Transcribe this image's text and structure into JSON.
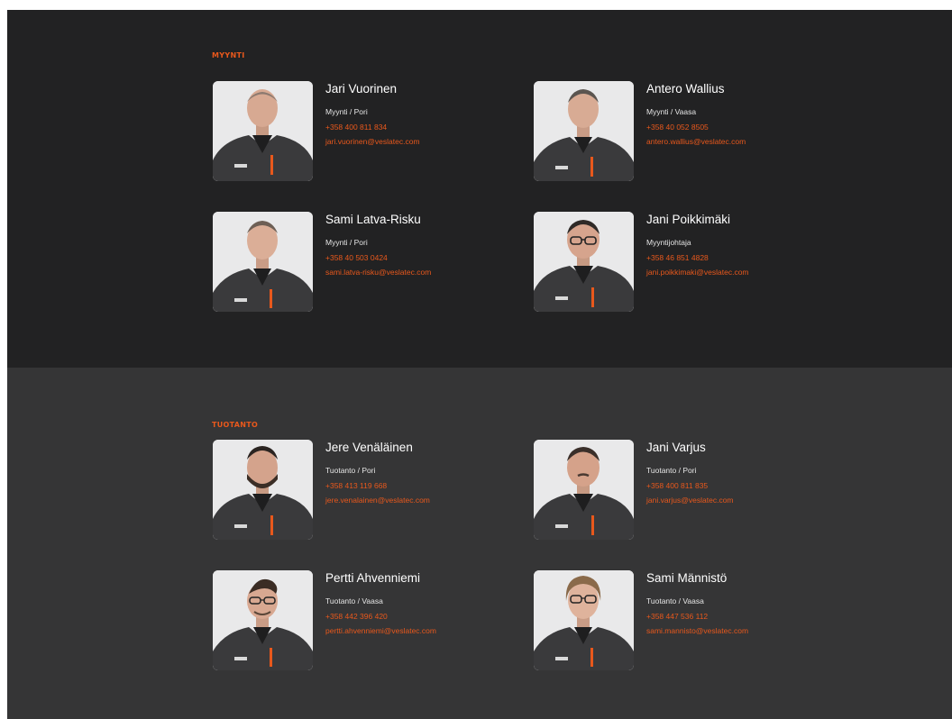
{
  "sections": {
    "sales": {
      "title": "MYYNTI",
      "people": [
        {
          "name": "Jari Vuorinen",
          "role": "Myynti / Pori",
          "phone": "+358 400 811 834",
          "email": "jari.vuorinen@veslatec.com"
        },
        {
          "name": "Antero Wallius",
          "role": "Myynti / Vaasa",
          "phone": "+358 40 052 8505",
          "email": "antero.wallius@veslatec.com"
        },
        {
          "name": "Sami Latva-Risku",
          "role": "Myynti / Pori",
          "phone": "+358 40 503 0424",
          "email": "sami.latva-risku@veslatec.com"
        },
        {
          "name": "Jani Poikkimäki",
          "role": "Myyntijohtaja",
          "phone": "+358 46 851 4828",
          "email": "jani.poikkimaki@veslatec.com"
        }
      ]
    },
    "production": {
      "title": "TUOTANTO",
      "people": [
        {
          "name": "Jere Venäläinen",
          "role": "Tuotanto / Pori",
          "phone": "+358 413 119 668",
          "email": "jere.venalainen@veslatec.com"
        },
        {
          "name": "Jani Varjus",
          "role": "Tuotanto / Pori",
          "phone": "+358 400 811 835",
          "email": "jani.varjus@veslatec.com"
        },
        {
          "name": "Pertti Ahvenniemi",
          "role": "Tuotanto / Vaasa",
          "phone": "+358 442 396 420",
          "email": "pertti.ahvenniemi@veslatec.com"
        },
        {
          "name": "Sami Männistö",
          "role": "Tuotanto / Vaasa",
          "phone": "+358 447 536 112",
          "email": "sami.mannisto@veslatec.com"
        }
      ]
    }
  },
  "icons": {
    "photo": "person-photo-icon"
  },
  "colors": {
    "accent": "#e8581c",
    "section_dark": "#222223",
    "section_mid": "#353536",
    "photo_bg": "#e9e9ea",
    "jacket": "#3a3a3c"
  }
}
